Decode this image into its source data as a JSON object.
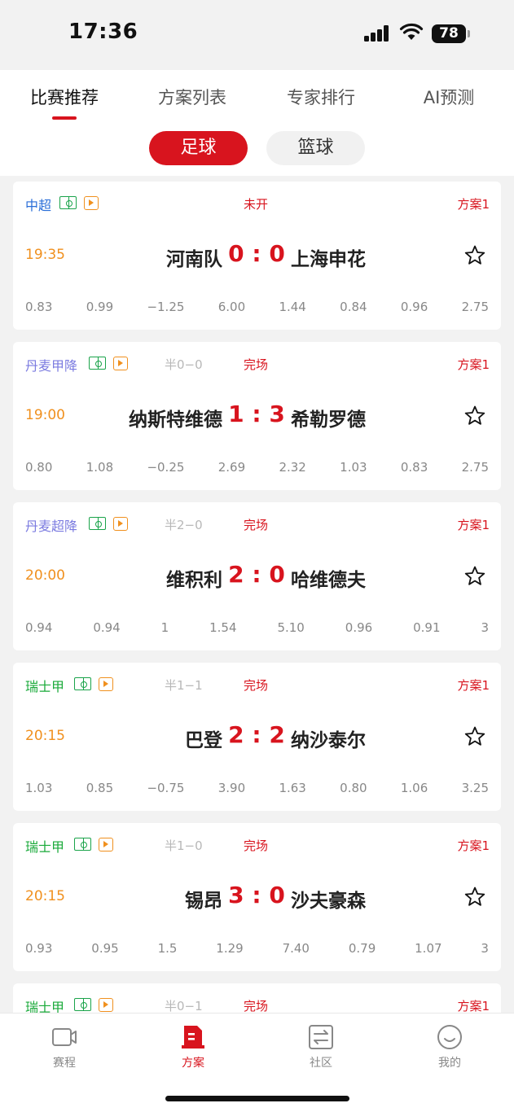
{
  "status_bar": {
    "time": "17:36",
    "battery": "78"
  },
  "tabs": [
    {
      "label": "比赛推荐",
      "active": true
    },
    {
      "label": "方案列表",
      "active": false
    },
    {
      "label": "专家排行",
      "active": false
    },
    {
      "label": "AI预测",
      "active": false
    }
  ],
  "segments": {
    "football": "足球",
    "basketball": "篮球"
  },
  "colors": {
    "accent": "#d8141e",
    "time": "#f0901e"
  },
  "matches": [
    {
      "league": "中超",
      "league_color": "#2a6ed8",
      "half": "",
      "status": "未开",
      "plan": "方案1",
      "time": "19:35",
      "home": "河南队",
      "score": "0 : 0",
      "away": "上海申花",
      "odds": [
        "0.83",
        "0.99",
        "−1.25",
        "6.00",
        "1.44",
        "0.84",
        "0.96",
        "2.75"
      ]
    },
    {
      "league": "丹麦甲降",
      "league_color": "#7b7be0",
      "half": "半0−0",
      "status": "完场",
      "plan": "方案1",
      "time": "19:00",
      "home": "纳斯特维德",
      "score": "1 : 3",
      "away": "希勒罗德",
      "odds": [
        "0.80",
        "1.08",
        "−0.25",
        "2.69",
        "2.32",
        "1.03",
        "0.83",
        "2.75"
      ]
    },
    {
      "league": "丹麦超降",
      "league_color": "#7b7be0",
      "half": "半2−0",
      "status": "完场",
      "plan": "方案1",
      "time": "20:00",
      "home": "维积利",
      "score": "2 : 0",
      "away": "哈维德夫",
      "odds": [
        "0.94",
        "0.94",
        "1",
        "1.54",
        "5.10",
        "0.96",
        "0.91",
        "3"
      ]
    },
    {
      "league": "瑞士甲",
      "league_color": "#1aaa3a",
      "half": "半1−1",
      "status": "完场",
      "plan": "方案1",
      "time": "20:15",
      "home": "巴登",
      "score": "2 : 2",
      "away": "纳沙泰尔",
      "odds": [
        "1.03",
        "0.85",
        "−0.75",
        "3.90",
        "1.63",
        "0.80",
        "1.06",
        "3.25"
      ]
    },
    {
      "league": "瑞士甲",
      "league_color": "#1aaa3a",
      "half": "半1−0",
      "status": "完场",
      "plan": "方案1",
      "time": "20:15",
      "home": "锡昂",
      "score": "3 : 0",
      "away": "沙夫豪森",
      "odds": [
        "0.93",
        "0.95",
        "1.5",
        "1.29",
        "7.40",
        "0.79",
        "1.07",
        "3"
      ]
    },
    {
      "league": "瑞士甲",
      "league_color": "#1aaa3a",
      "half": "半0−1",
      "status": "完场",
      "plan": "方案1"
    }
  ],
  "tabbar": [
    {
      "label": "赛程",
      "icon": "video-camera-icon",
      "active": false
    },
    {
      "label": "方案",
      "icon": "document-icon",
      "active": true
    },
    {
      "label": "社区",
      "icon": "swap-icon",
      "active": false
    },
    {
      "label": "我的",
      "icon": "smiley-icon",
      "active": false
    }
  ]
}
